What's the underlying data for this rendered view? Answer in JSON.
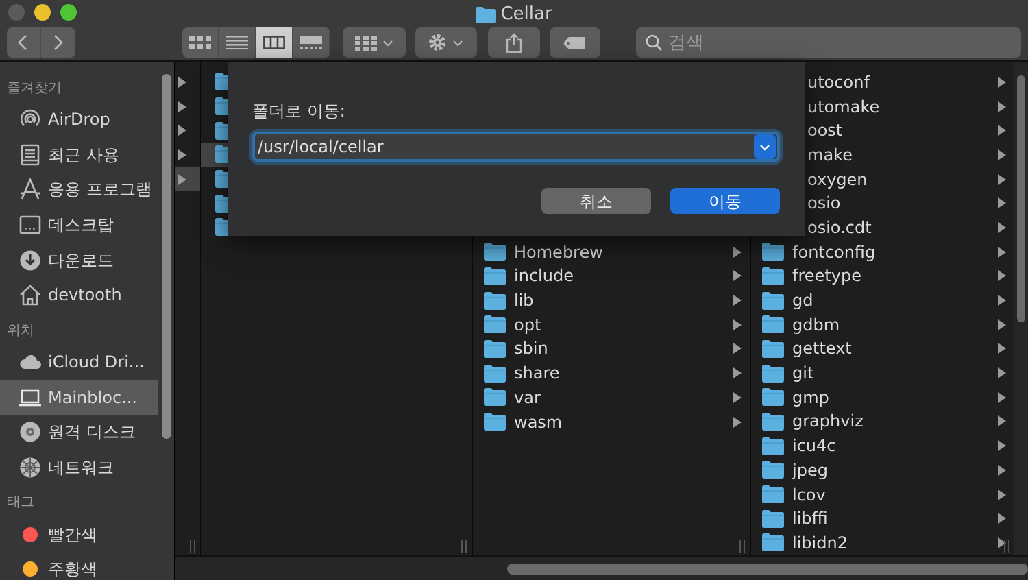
{
  "window": {
    "title": "Cellar"
  },
  "toolbar": {
    "view_modes": [
      {
        "kind": "icons",
        "selected": false
      },
      {
        "kind": "list",
        "selected": false
      },
      {
        "kind": "columns",
        "selected": true
      },
      {
        "kind": "gallery",
        "selected": false
      }
    ],
    "search": {
      "placeholder": "검색"
    }
  },
  "sidebar": {
    "sections": [
      {
        "title": "즐겨찾기",
        "items": [
          {
            "label": "AirDrop",
            "kind": "airdrop",
            "selected": false
          },
          {
            "label": "최근 사용",
            "kind": "recent",
            "selected": false
          },
          {
            "label": "응용 프로그램",
            "kind": "apps",
            "selected": false
          },
          {
            "label": "데스크탑",
            "kind": "desktop",
            "selected": false
          },
          {
            "label": "다운로드",
            "kind": "download",
            "selected": false
          },
          {
            "label": "devtooth",
            "kind": "home",
            "selected": false
          }
        ]
      },
      {
        "title": "위치",
        "items": [
          {
            "label": "iCloud Dri...",
            "kind": "cloud",
            "selected": false
          },
          {
            "label": "Mainbloc...",
            "kind": "laptop",
            "selected": true
          },
          {
            "label": "원격 디스크",
            "kind": "disc",
            "selected": false
          },
          {
            "label": "네트워크",
            "kind": "network",
            "selected": false
          }
        ]
      },
      {
        "title": "태그",
        "items": [
          {
            "label": "빨간색",
            "kind": "tag",
            "color": "#fc5753",
            "selected": false
          },
          {
            "label": "주황색",
            "kind": "tag",
            "color": "#fdb02e",
            "selected": false
          }
        ]
      }
    ]
  },
  "columns": [
    {
      "rows": [
        {
          "selected": false
        },
        {
          "selected": false
        },
        {
          "selected": false
        },
        {
          "selected": false
        },
        {
          "selected": true
        }
      ]
    },
    {
      "rows": [
        {
          "selected": false
        },
        {
          "selected": false
        },
        {
          "selected": false
        },
        {
          "selected": true
        },
        {
          "selected": false
        },
        {
          "selected": false
        },
        {
          "selected": false
        }
      ]
    },
    {
      "rows": [
        {
          "label": "Homebrew",
          "kind": "folder"
        },
        {
          "label": "include",
          "kind": "folder"
        },
        {
          "label": "lib",
          "kind": "folder"
        },
        {
          "label": "opt",
          "kind": "folder"
        },
        {
          "label": "sbin",
          "kind": "folder"
        },
        {
          "label": "share",
          "kind": "folder"
        },
        {
          "label": "var",
          "kind": "folder"
        },
        {
          "label": "wasm",
          "kind": "folder"
        }
      ]
    },
    {
      "rows": [
        {
          "label": "utoconf",
          "kind": "covered"
        },
        {
          "label": "utomake",
          "kind": "covered"
        },
        {
          "label": "oost",
          "kind": "covered"
        },
        {
          "label": "make",
          "kind": "covered"
        },
        {
          "label": "oxygen",
          "kind": "covered"
        },
        {
          "label": "osio",
          "kind": "covered"
        },
        {
          "label": "osio.cdt",
          "kind": "covered"
        },
        {
          "label": "fontconfig",
          "kind": "folder"
        },
        {
          "label": "freetype",
          "kind": "folder"
        },
        {
          "label": "gd",
          "kind": "folder"
        },
        {
          "label": "gdbm",
          "kind": "folder"
        },
        {
          "label": "gettext",
          "kind": "folder"
        },
        {
          "label": "git",
          "kind": "folder"
        },
        {
          "label": "gmp",
          "kind": "folder"
        },
        {
          "label": "graphviz",
          "kind": "folder"
        },
        {
          "label": "icu4c",
          "kind": "folder"
        },
        {
          "label": "jpeg",
          "kind": "folder"
        },
        {
          "label": "lcov",
          "kind": "folder"
        },
        {
          "label": "libffi",
          "kind": "folder"
        },
        {
          "label": "libidn2",
          "kind": "folder"
        }
      ]
    }
  ],
  "dialog": {
    "label": "폴더로 이동:",
    "path": "/usr/local/cellar",
    "buttons": [
      {
        "label": "취소",
        "default": false
      },
      {
        "label": "이동",
        "default": true
      }
    ]
  }
}
